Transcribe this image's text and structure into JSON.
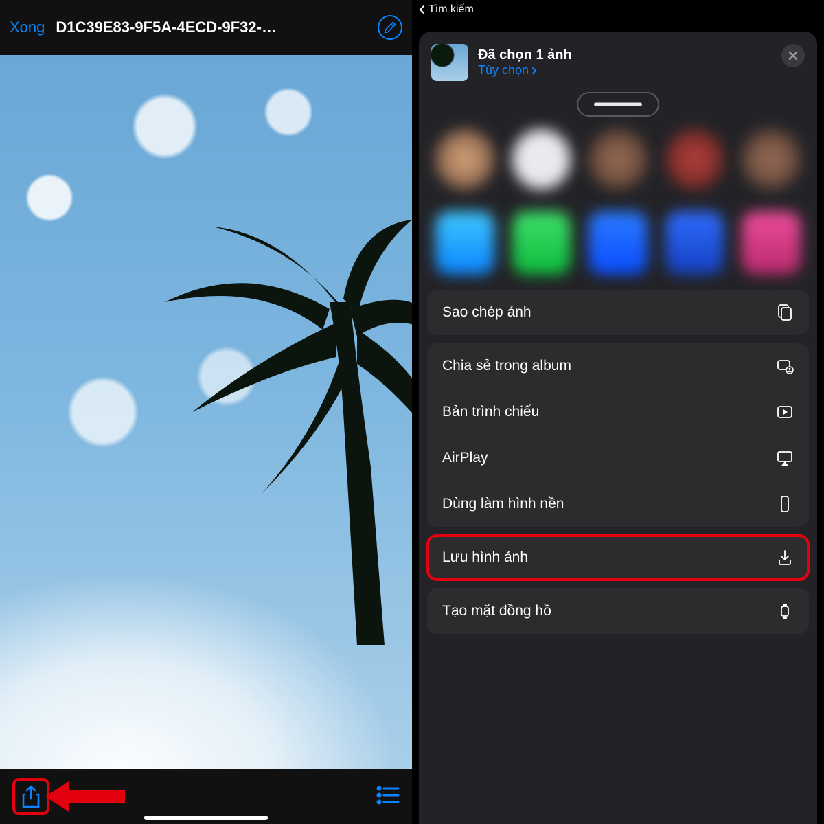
{
  "left": {
    "done_label": "Xong",
    "file_title": "D1C39E83-9F5A-4ECD-9F32-…",
    "icons": {
      "markup": "markup-icon",
      "share": "share-icon",
      "list": "list-icon"
    }
  },
  "right": {
    "back_label": "Tìm kiếm",
    "header": {
      "title": "Đã chọn 1 ảnh",
      "options_label": "Tùy chọn"
    },
    "actions": {
      "copy": "Sao chép ảnh",
      "share_album": "Chia sẻ trong album",
      "slideshow": "Bản trình chiếu",
      "airplay": "AirPlay",
      "wallpaper": "Dùng làm hình nền",
      "save_image": "Lưu hình ảnh",
      "watch_face": "Tạo mặt đồng hồ"
    }
  },
  "colors": {
    "accent": "#0a84ff",
    "highlight": "#e3000f"
  }
}
